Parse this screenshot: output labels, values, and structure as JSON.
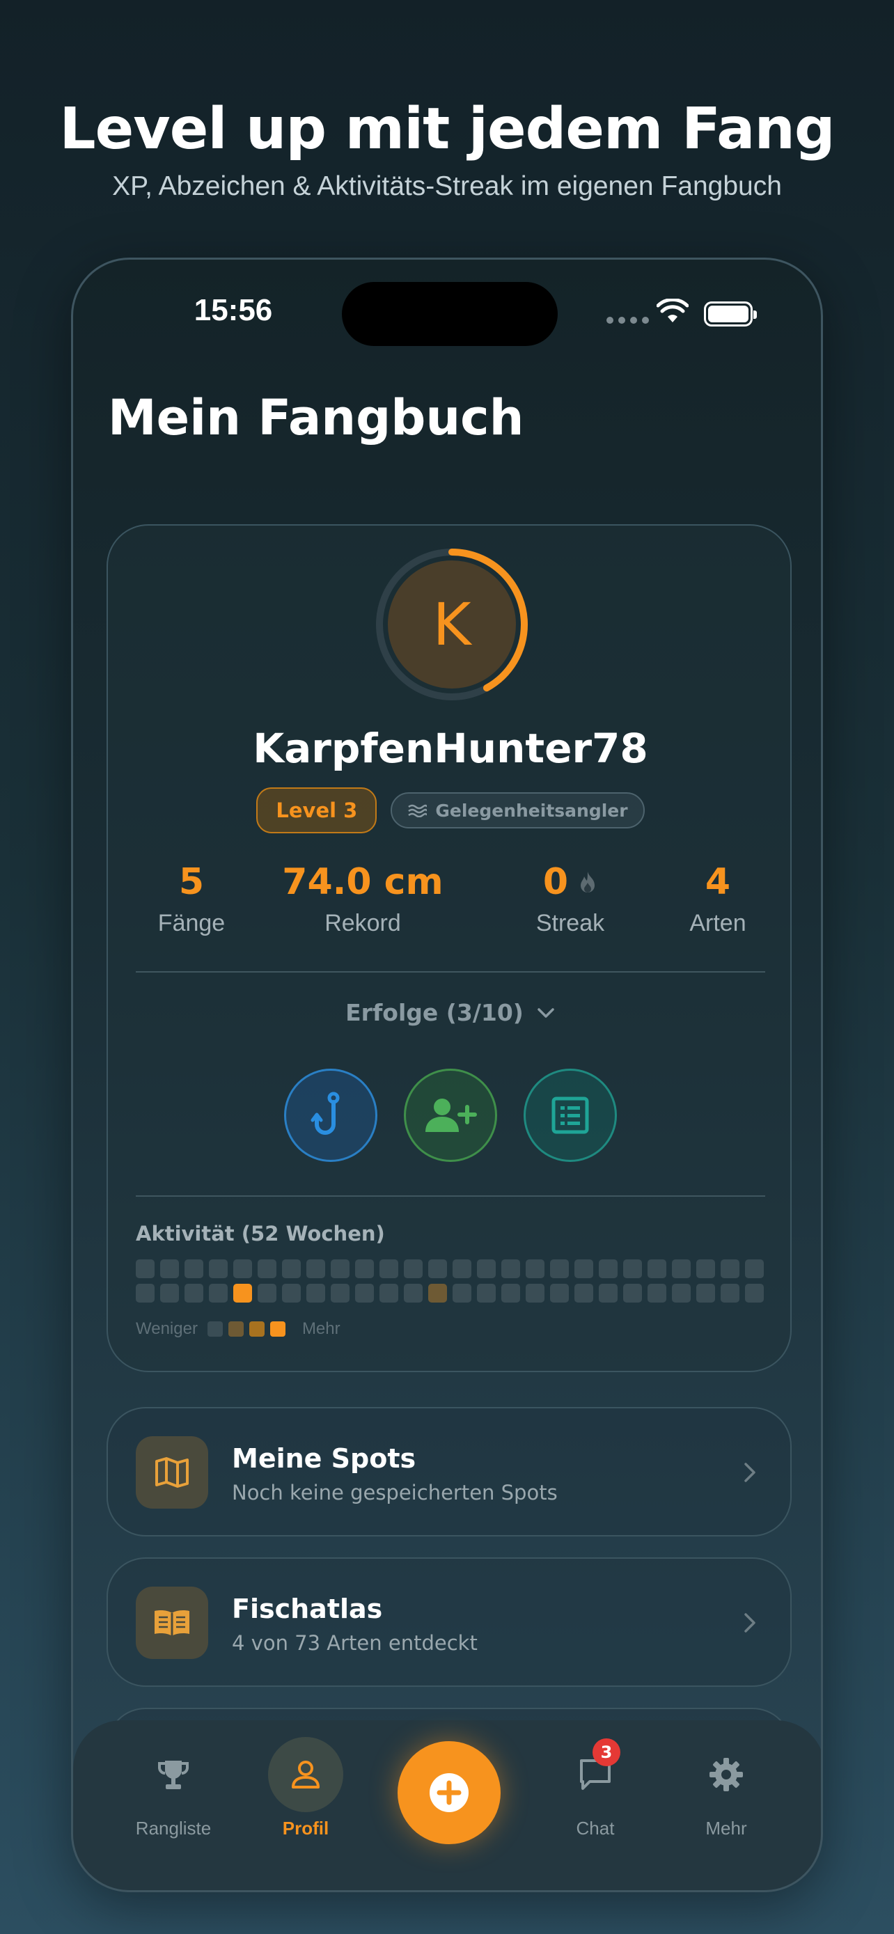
{
  "promo": {
    "title": "Level up mit jedem Fang",
    "subtitle": "XP, Abzeichen & Aktivitäts-Streak im eigenen Fangbuch"
  },
  "status_bar": {
    "time": "15:56"
  },
  "page": {
    "title": "Mein Fangbuch"
  },
  "profile": {
    "avatar_letter": "K",
    "level_progress": 0.42,
    "username": "KarpfenHunter78",
    "level_badge": "Level 3",
    "type_badge": "Gelegenheitsangler",
    "stats": [
      {
        "value": "5",
        "label": "Fänge"
      },
      {
        "value": "74.0 cm",
        "label": "Rekord"
      },
      {
        "value": "0",
        "label": "Streak"
      },
      {
        "value": "4",
        "label": "Arten"
      }
    ],
    "achievements_label": "Erfolge (3/10)",
    "achievement_icons": [
      "hook-icon",
      "add-friend-icon",
      "logbook-icon"
    ],
    "activity": {
      "title": "Aktivität (52 Wochen)",
      "legend_less": "Weniger",
      "legend_more": "Mehr",
      "active_cells": [
        {
          "row": 1,
          "col": 4,
          "level": 3
        },
        {
          "row": 1,
          "col": 12,
          "level": 1
        }
      ]
    }
  },
  "menu": [
    {
      "title": "Meine Spots",
      "subtitle": "Noch keine gespeicherten Spots",
      "icon": "map-icon"
    },
    {
      "title": "Fischatlas",
      "subtitle": "4 von 73 Arten entdeckt",
      "icon": "book-icon"
    }
  ],
  "tabbar": {
    "items": [
      {
        "label": "Rangliste",
        "icon": "trophy-icon",
        "active": false
      },
      {
        "label": "Profil",
        "icon": "person-icon",
        "active": true
      },
      {
        "label": "Chat",
        "icon": "chat-icon",
        "active": false,
        "badge": "3"
      },
      {
        "label": "Mehr",
        "icon": "gear-icon",
        "active": false
      }
    ],
    "fab_icon": "plus-icon"
  },
  "colors": {
    "accent": "#f7931e",
    "background": "#1a2d35",
    "badge_red": "#e53935"
  }
}
